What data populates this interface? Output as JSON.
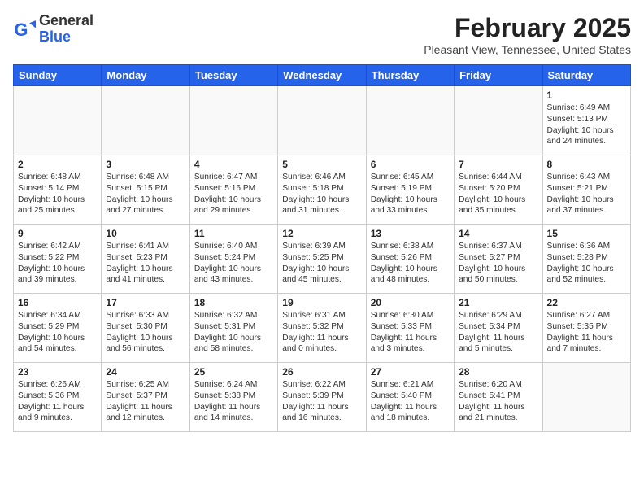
{
  "header": {
    "logo_general": "General",
    "logo_blue": "Blue",
    "month_title": "February 2025",
    "location": "Pleasant View, Tennessee, United States"
  },
  "weekdays": [
    "Sunday",
    "Monday",
    "Tuesday",
    "Wednesday",
    "Thursday",
    "Friday",
    "Saturday"
  ],
  "weeks": [
    [
      {
        "day": "",
        "info": ""
      },
      {
        "day": "",
        "info": ""
      },
      {
        "day": "",
        "info": ""
      },
      {
        "day": "",
        "info": ""
      },
      {
        "day": "",
        "info": ""
      },
      {
        "day": "",
        "info": ""
      },
      {
        "day": "1",
        "info": "Sunrise: 6:49 AM\nSunset: 5:13 PM\nDaylight: 10 hours and 24 minutes."
      }
    ],
    [
      {
        "day": "2",
        "info": "Sunrise: 6:48 AM\nSunset: 5:14 PM\nDaylight: 10 hours and 25 minutes."
      },
      {
        "day": "3",
        "info": "Sunrise: 6:48 AM\nSunset: 5:15 PM\nDaylight: 10 hours and 27 minutes."
      },
      {
        "day": "4",
        "info": "Sunrise: 6:47 AM\nSunset: 5:16 PM\nDaylight: 10 hours and 29 minutes."
      },
      {
        "day": "5",
        "info": "Sunrise: 6:46 AM\nSunset: 5:18 PM\nDaylight: 10 hours and 31 minutes."
      },
      {
        "day": "6",
        "info": "Sunrise: 6:45 AM\nSunset: 5:19 PM\nDaylight: 10 hours and 33 minutes."
      },
      {
        "day": "7",
        "info": "Sunrise: 6:44 AM\nSunset: 5:20 PM\nDaylight: 10 hours and 35 minutes."
      },
      {
        "day": "8",
        "info": "Sunrise: 6:43 AM\nSunset: 5:21 PM\nDaylight: 10 hours and 37 minutes."
      }
    ],
    [
      {
        "day": "9",
        "info": "Sunrise: 6:42 AM\nSunset: 5:22 PM\nDaylight: 10 hours and 39 minutes."
      },
      {
        "day": "10",
        "info": "Sunrise: 6:41 AM\nSunset: 5:23 PM\nDaylight: 10 hours and 41 minutes."
      },
      {
        "day": "11",
        "info": "Sunrise: 6:40 AM\nSunset: 5:24 PM\nDaylight: 10 hours and 43 minutes."
      },
      {
        "day": "12",
        "info": "Sunrise: 6:39 AM\nSunset: 5:25 PM\nDaylight: 10 hours and 45 minutes."
      },
      {
        "day": "13",
        "info": "Sunrise: 6:38 AM\nSunset: 5:26 PM\nDaylight: 10 hours and 48 minutes."
      },
      {
        "day": "14",
        "info": "Sunrise: 6:37 AM\nSunset: 5:27 PM\nDaylight: 10 hours and 50 minutes."
      },
      {
        "day": "15",
        "info": "Sunrise: 6:36 AM\nSunset: 5:28 PM\nDaylight: 10 hours and 52 minutes."
      }
    ],
    [
      {
        "day": "16",
        "info": "Sunrise: 6:34 AM\nSunset: 5:29 PM\nDaylight: 10 hours and 54 minutes."
      },
      {
        "day": "17",
        "info": "Sunrise: 6:33 AM\nSunset: 5:30 PM\nDaylight: 10 hours and 56 minutes."
      },
      {
        "day": "18",
        "info": "Sunrise: 6:32 AM\nSunset: 5:31 PM\nDaylight: 10 hours and 58 minutes."
      },
      {
        "day": "19",
        "info": "Sunrise: 6:31 AM\nSunset: 5:32 PM\nDaylight: 11 hours and 0 minutes."
      },
      {
        "day": "20",
        "info": "Sunrise: 6:30 AM\nSunset: 5:33 PM\nDaylight: 11 hours and 3 minutes."
      },
      {
        "day": "21",
        "info": "Sunrise: 6:29 AM\nSunset: 5:34 PM\nDaylight: 11 hours and 5 minutes."
      },
      {
        "day": "22",
        "info": "Sunrise: 6:27 AM\nSunset: 5:35 PM\nDaylight: 11 hours and 7 minutes."
      }
    ],
    [
      {
        "day": "23",
        "info": "Sunrise: 6:26 AM\nSunset: 5:36 PM\nDaylight: 11 hours and 9 minutes."
      },
      {
        "day": "24",
        "info": "Sunrise: 6:25 AM\nSunset: 5:37 PM\nDaylight: 11 hours and 12 minutes."
      },
      {
        "day": "25",
        "info": "Sunrise: 6:24 AM\nSunset: 5:38 PM\nDaylight: 11 hours and 14 minutes."
      },
      {
        "day": "26",
        "info": "Sunrise: 6:22 AM\nSunset: 5:39 PM\nDaylight: 11 hours and 16 minutes."
      },
      {
        "day": "27",
        "info": "Sunrise: 6:21 AM\nSunset: 5:40 PM\nDaylight: 11 hours and 18 minutes."
      },
      {
        "day": "28",
        "info": "Sunrise: 6:20 AM\nSunset: 5:41 PM\nDaylight: 11 hours and 21 minutes."
      },
      {
        "day": "",
        "info": ""
      }
    ]
  ]
}
